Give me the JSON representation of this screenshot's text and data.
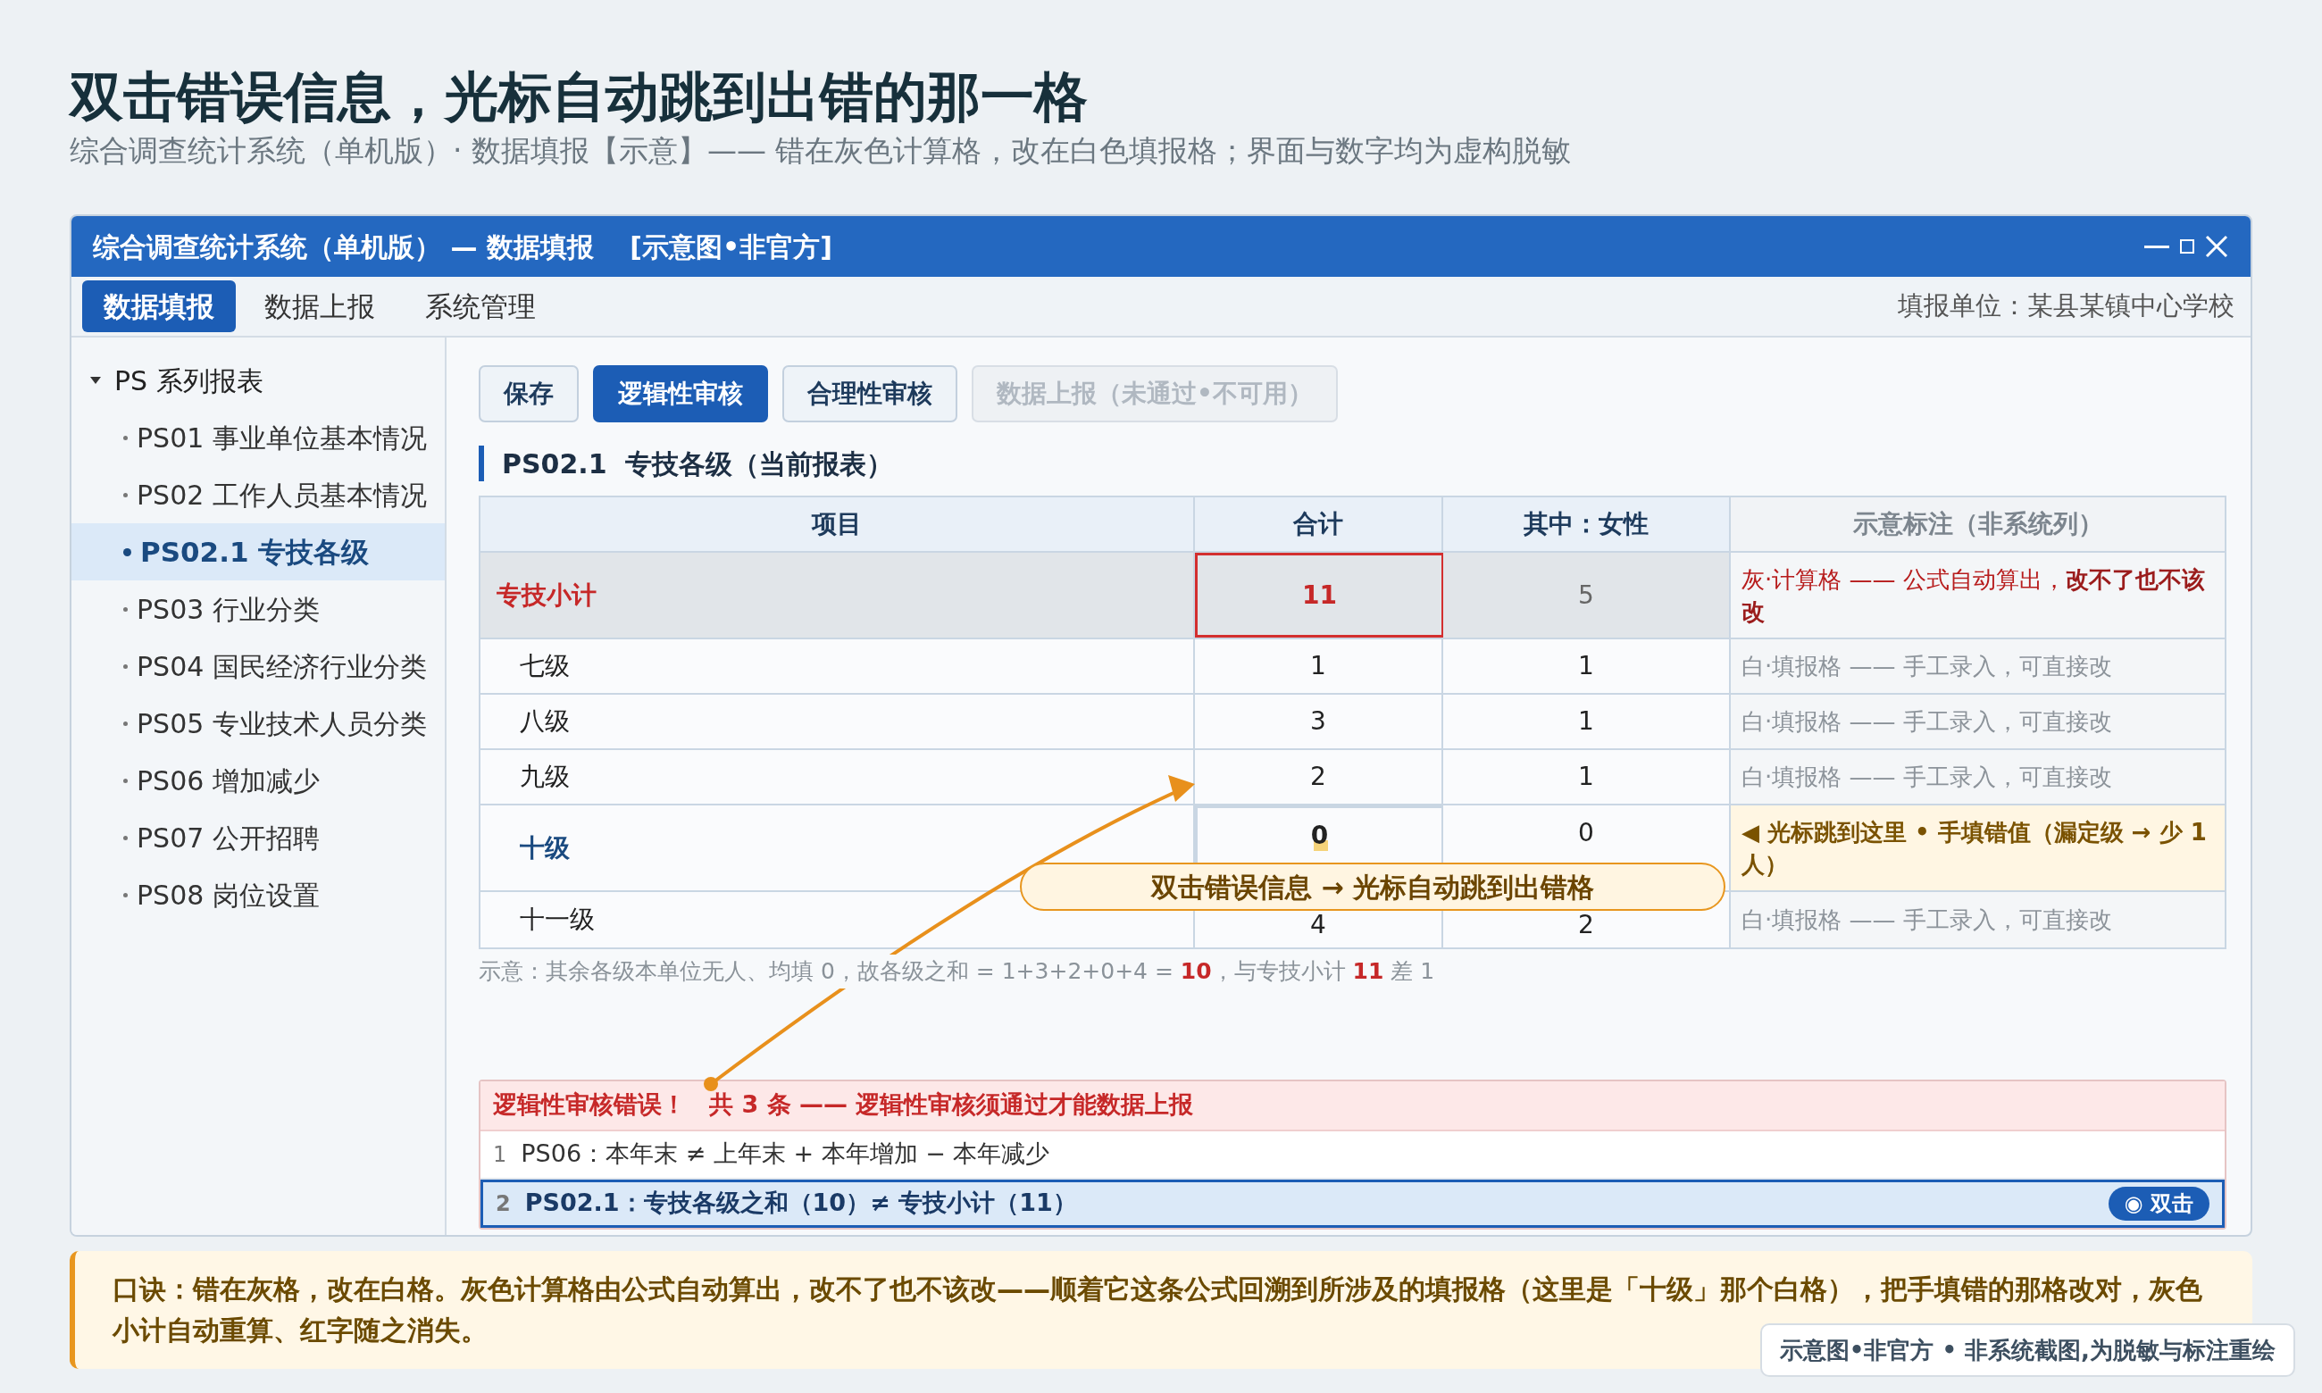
{
  "heading": {
    "title": "双击错误信息，光标自动跳到出错的那一格",
    "subtitle": "综合调查统计系统（单机版）· 数据填报【示意】—— 错在灰色计算格，改在白色填报格；界面与数字均为虚构脱敏"
  },
  "window": {
    "title": "综合调查统计系统（单机版） — 数据填报　 [示意图•非官方]"
  },
  "menu": {
    "tabs": [
      {
        "label": "数据填报",
        "selected": true
      },
      {
        "label": "数据上报",
        "selected": false
      },
      {
        "label": "系统管理",
        "selected": false
      }
    ],
    "unit": "填报单位：某县某镇中心学校"
  },
  "sidebar": {
    "group": {
      "label": "PS 系列报表",
      "expanded": true,
      "children": [
        {
          "label": "PS01 事业单位基本情况",
          "selected": false
        },
        {
          "label": "PS02 工作人员基本情况",
          "selected": false
        },
        {
          "label": "PS02.1 专技各级",
          "selected": true
        },
        {
          "label": "PS03 行业分类",
          "selected": false
        },
        {
          "label": "PS04 国民经济行业分类",
          "selected": false
        },
        {
          "label": "PS05 专业技术人员分类",
          "selected": false
        },
        {
          "label": "PS06 增加减少",
          "selected": false
        },
        {
          "label": "PS07 公开招聘",
          "selected": false
        },
        {
          "label": "PS08 岗位设置",
          "selected": false
        }
      ]
    }
  },
  "toolbar": {
    "buttons": [
      {
        "label": "保存",
        "kind": "default"
      },
      {
        "label": "逻辑性审核",
        "kind": "primary"
      },
      {
        "label": "合理性审核",
        "kind": "default"
      },
      {
        "label": "数据上报（未通过•不可用）",
        "kind": "disabled"
      }
    ]
  },
  "report": {
    "code": "PS02.1",
    "name": "专技各级（当前报表）"
  },
  "table": {
    "columns": [
      "项目",
      "合计",
      "其中：女性",
      "示意标注（非系统列）"
    ],
    "rows": [
      {
        "kind": "computed",
        "label": "专技小计",
        "total": "11",
        "female": "5",
        "note": "灰·计算格 —— 公式自动算出，**改不了也不该改**"
      },
      {
        "kind": "input",
        "label": "七级",
        "total": "1",
        "female": "1",
        "note": "白·填报格 —— 手工录入，可直接改"
      },
      {
        "kind": "input",
        "label": "八级",
        "total": "3",
        "female": "1",
        "note": "白·填报格 —— 手工录入，可直接改"
      },
      {
        "kind": "input",
        "label": "九级",
        "total": "2",
        "female": "1",
        "note": "白·填报格 —— 手工录入，可直接改"
      },
      {
        "kind": "cursor",
        "label": "十级",
        "total": "0",
        "female": "0",
        "note": "◀ 光标跳到这里 • 手填错值（漏定级 → 少 1 人）"
      },
      {
        "kind": "input",
        "label": "十一级",
        "total": "4",
        "female": "2",
        "note": "白·填报格 —— 手工录入，可直接改"
      }
    ]
  },
  "footnote": "示意：其余各级本单位无人、均填 0，故各级之和 = 1+3+2+0+4 = **10**，与专技小计 **11** 差 1",
  "callout": "双击错误信息 → 光标自动跳到出错格",
  "errors": {
    "title": "逻辑性审核错误！",
    "summary": "共 3 条 —— 逻辑性审核须通过才能数据上报",
    "items": [
      {
        "index": "1",
        "text": "PS06：本年末 ≠ 上年末 + 本年增加 − 本年减少",
        "selected": false
      },
      {
        "index": "2",
        "text": "PS02.1：专技各级之和（10）≠ 专技小计（11）",
        "selected": true,
        "action": "◉ 双击"
      }
    ]
  },
  "tip": "口诀：错在灰格，改在白格。灰色计算格由公式自动算出，改不了也不该改——顺着它这条公式回溯到所涉及的填报格（这里是「十级」那个白格），把手填错的那格改对，灰色小计自动重算、红字随之消失。",
  "badge": "示意图•非官方 • 非系统截图,为脱敏与标注重绘"
}
